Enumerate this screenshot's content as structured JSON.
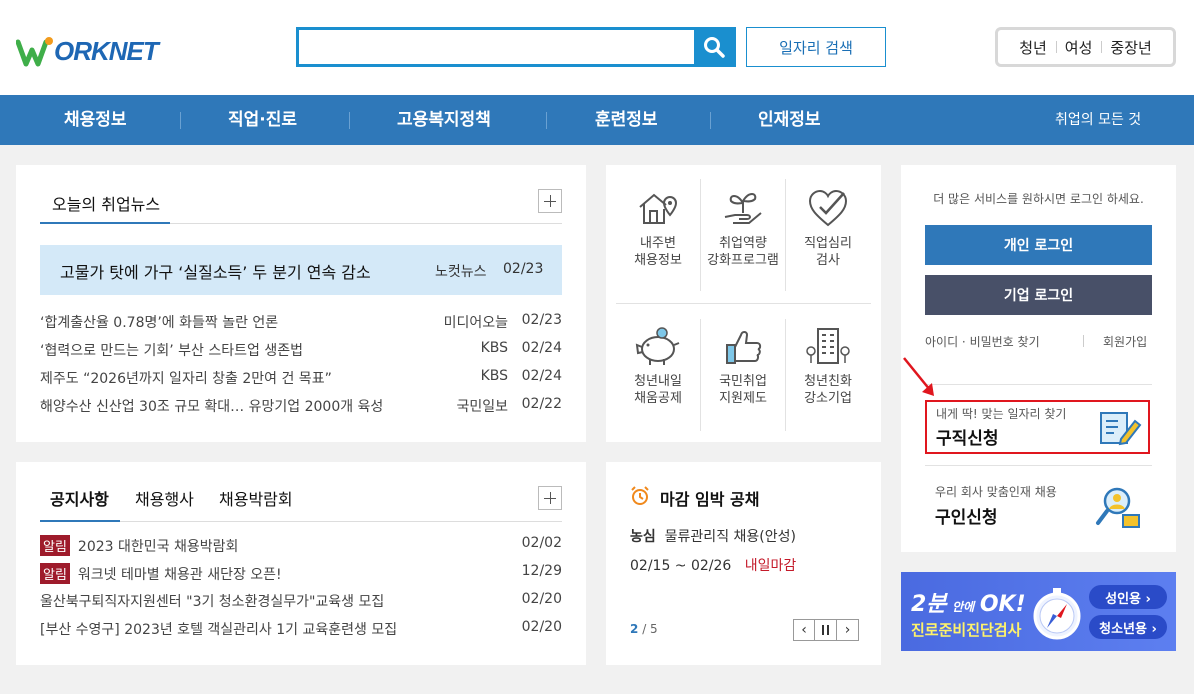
{
  "header": {
    "logo_text": "ORKNET",
    "search_placeholder": "",
    "job_search_label": "일자리 검색",
    "persona": [
      "청년",
      "여성",
      "중장년"
    ]
  },
  "gnb": {
    "items": [
      "채용정보",
      "직업·진로",
      "고용복지정책",
      "훈련정보",
      "인재정보"
    ],
    "all_label": "취업의 모든 것"
  },
  "news": {
    "tab": "오늘의 취업뉴스",
    "headline": {
      "title": "고물가 탓에 가구 ‘실질소득’ 두 분기 연속 감소",
      "source": "노컷뉴스",
      "date": "02/23"
    },
    "items": [
      {
        "title": "‘합계출산율 0.78명’에 화들짝 놀란 언론",
        "source": "미디어오늘",
        "date": "02/23"
      },
      {
        "title": "‘협력으로 만드는 기회’ 부산 스타트업 생존법",
        "source": "KBS",
        "date": "02/24"
      },
      {
        "title": "제주도 “2026년까지 일자리 창출 2만여 건 목표”",
        "source": "KBS",
        "date": "02/24"
      },
      {
        "title": "해양수산 신산업 30조 규모 확대… 유망기업 2000개 육성",
        "source": "국민일보",
        "date": "02/22"
      }
    ]
  },
  "notice": {
    "tabs": [
      "공지사항",
      "채용행사",
      "채용박람회"
    ],
    "items": [
      {
        "badge": "알림",
        "title": "2023 대한민국 채용박람회",
        "date": "02/02"
      },
      {
        "badge": "알림",
        "title": "워크넷 테마별 채용관 새단장 오픈!",
        "date": "12/29"
      },
      {
        "badge": "",
        "title": "울산북구퇴직자지원센터 \"3기 청소환경실무가\"교육생 모집",
        "date": "02/20"
      },
      {
        "badge": "",
        "title": "[부산 수영구] 2023년 호텔 객실관리사 1기 교육훈련생 모집",
        "date": "02/20"
      }
    ]
  },
  "services": [
    {
      "line1": "내주변",
      "line2": "채용정보",
      "icon": "house-location-icon"
    },
    {
      "line1": "취업역량",
      "line2": "강화프로그램",
      "icon": "sprout-hand-icon"
    },
    {
      "line1": "직업심리",
      "line2": "검사",
      "icon": "heart-check-icon"
    },
    {
      "line1": "청년내일",
      "line2": "채움공제",
      "icon": "piggy-bank-icon"
    },
    {
      "line1": "국민취업",
      "line2": "지원제도",
      "icon": "thumbs-up-icon"
    },
    {
      "line1": "청년친화",
      "line2": "강소기업",
      "icon": "building-icon"
    }
  ],
  "deadline": {
    "title": "마감 임박 공채",
    "company": "농심",
    "job": "물류관리직 채용(안성)",
    "period": "02/15 ~ 02/26",
    "status": "내일마감",
    "page_current": "2",
    "page_total": "/ 5"
  },
  "login": {
    "notice": "더 많은 서비스를 원하시면 로그인 하세요.",
    "personal": "개인 로그인",
    "company": "기업 로그인",
    "find": "아이디 · 비밀번호 찾기",
    "join": "회원가입",
    "job_seek_sub": "내게 딱! 맞는 일자리 찾기",
    "job_seek_title": "구직신청",
    "hire_sub": "우리 회사 맞춤인재 채용",
    "hire_title": "구인신청"
  },
  "banner": {
    "line1_a": "2분",
    "line1_b": "안에",
    "line1_c": "OK!",
    "line2": "진로준비진단검사",
    "adult": "성인용 ›",
    "youth": "청소년용 ›"
  },
  "colors": {
    "brand_blue": "#2f78b9",
    "accent_red": "#e0161e",
    "alert_badge": "#9e1b2b"
  }
}
